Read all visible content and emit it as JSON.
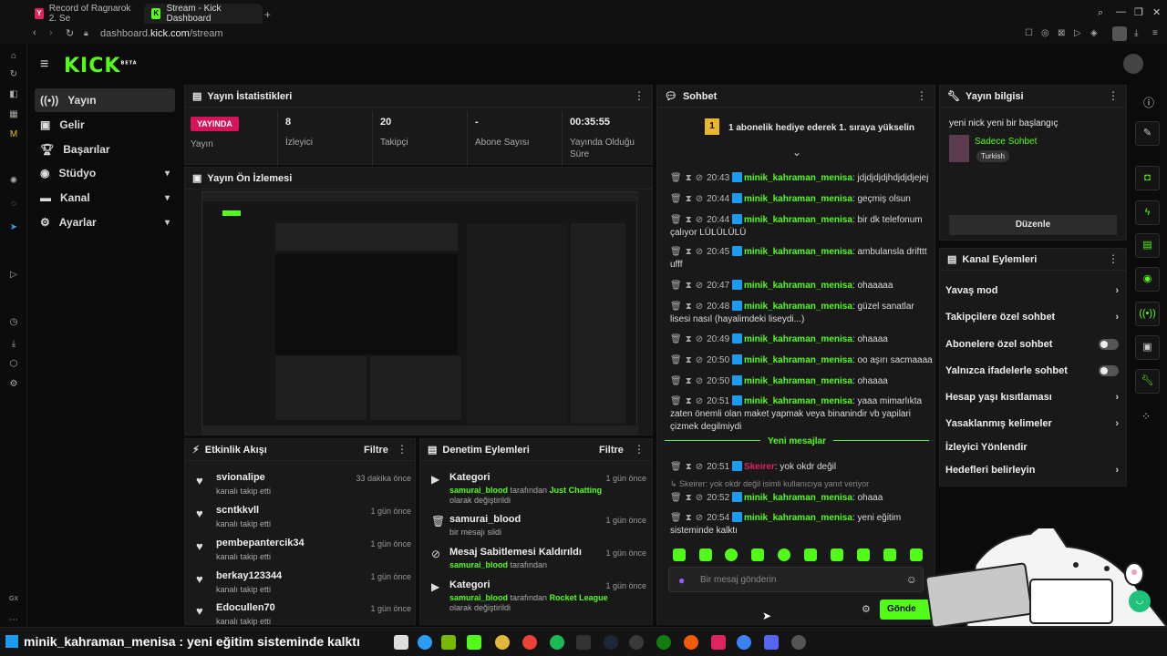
{
  "browser": {
    "tabs": [
      {
        "title": "Record of Ragnarok 2. Se",
        "favicon": "Y"
      },
      {
        "title": "Stream - Kick Dashboard",
        "favicon": "K"
      }
    ],
    "url_prefix": "dashboard.",
    "url_domain": "kick.com",
    "url_path": "/stream"
  },
  "app": {
    "logo": "KICK",
    "logo_tag": "BETA"
  },
  "sidebar": {
    "items": [
      {
        "label": "Yayın",
        "icon": "radio-icon"
      },
      {
        "label": "Gelir",
        "icon": "revenue-icon"
      },
      {
        "label": "Başarılar",
        "icon": "trophy-icon"
      },
      {
        "label": "Stüdyo",
        "icon": "studio-icon"
      },
      {
        "label": "Kanal",
        "icon": "channel-icon"
      },
      {
        "label": "Ayarlar",
        "icon": "gear-icon"
      }
    ]
  },
  "stats": {
    "title": "Yayın İstatistikleri",
    "live_badge": "YAYINDA",
    "live_label": "Yayın",
    "cells": [
      {
        "value": "8",
        "label": "İzleyici"
      },
      {
        "value": "20",
        "label": "Takipçi"
      },
      {
        "value": "-",
        "label": "Abone Sayısı"
      },
      {
        "value": "00:35:55",
        "label": "Yayında Olduğu Süre"
      }
    ]
  },
  "preview": {
    "title": "Yayın Ön İzlemesi"
  },
  "activity": {
    "title": "Etkinlik Akışı",
    "filter": "Filtre",
    "rows": [
      {
        "name": "svionalipe",
        "sub": "kanalı takip etti",
        "time": "33 dakika önce"
      },
      {
        "name": "scntkkvll",
        "sub": "kanalı takip etti",
        "time": "1 gün önce"
      },
      {
        "name": "pembepantercik34",
        "sub": "kanalı takip etti",
        "time": "1 gün önce"
      },
      {
        "name": "berkay123344",
        "sub": "kanalı takip etti",
        "time": "1 gün önce"
      },
      {
        "name": "Edocullen70",
        "sub": "kanalı takip etti",
        "time": "1 gün önce"
      }
    ]
  },
  "moderation": {
    "title": "Denetim Eylemleri",
    "filter": "Filtre",
    "rows": [
      {
        "name": "Kategori",
        "user": "samurai_blood",
        "mid": " tarafından ",
        "hl": "Just Chatting",
        "tail": " olarak değiştirildi",
        "time": "1 gün önce"
      },
      {
        "name": "samurai_blood",
        "user": "",
        "mid": "bir mesajı sildi",
        "hl": "",
        "tail": "",
        "time": "1 gün önce"
      },
      {
        "name": "Mesaj Sabitlemesi Kaldırıldı",
        "user": "samurai_blood",
        "mid": " tarafından",
        "hl": "",
        "tail": "",
        "time": "1 gün önce"
      },
      {
        "name": "Kategori",
        "user": "samurai_blood",
        "mid": " tarafından ",
        "hl": "Rocket League",
        "tail": " olarak değiştirildi",
        "time": "1 gün önce"
      }
    ]
  },
  "chat": {
    "title": "Sohbet",
    "gift_text": "1 abonelik hediye ederek 1. sıraya yükselin",
    "gift_rank": "1",
    "messages": [
      {
        "time": "20:43",
        "user": "minik_kahraman_menisa",
        "text": "jdjdjdjdjhdjdjdjejej"
      },
      {
        "time": "20:44",
        "user": "minik_kahraman_menisa",
        "text": "geçmiş olsun"
      },
      {
        "time": "20:44",
        "user": "minik_kahraman_menisa",
        "text": "bir dk telefonum çalıyor LÜLÜLÜLÜ"
      },
      {
        "time": "20:45",
        "user": "minik_kahraman_menisa",
        "text": "ambulansla drifttt ufff"
      },
      {
        "time": "20:47",
        "user": "minik_kahraman_menisa",
        "text": "ohaaaaa"
      },
      {
        "time": "20:48",
        "user": "minik_kahraman_menisa",
        "text": "güzel sanatlar lisesi nasıl (hayalimdeki liseydi...)"
      },
      {
        "time": "20:49",
        "user": "minik_kahraman_menisa",
        "text": "ohaaaa"
      },
      {
        "time": "20:50",
        "user": "minik_kahraman_menisa",
        "text": "oo aşırı sacmaaaa"
      },
      {
        "time": "20:50",
        "user": "minik_kahraman_menisa",
        "text": "ohaaaa"
      },
      {
        "time": "20:51",
        "user": "minik_kahraman_menisa",
        "text": "yaaa mimarlıkta zaten önemli olan maket yapmak veya binanindir vb yapilari çizmek degilmiydi"
      }
    ],
    "new_divider": "Yeni mesajlar",
    "after": [
      {
        "time": "20:51",
        "user": "Skeirer",
        "text": "yok okdr değil",
        "red": true
      },
      {
        "time": "20:52",
        "user": "minik_kahraman_menisa",
        "text": "ohaaa"
      },
      {
        "time": "20:54",
        "user": "minik_kahraman_menisa",
        "text": "yeni eğitim sisteminde kalktı"
      }
    ],
    "reply_note": "Skeirer: yok okdr değil isimli kullanıcıya yanıt veriyor",
    "input_placeholder": "Bir mesaj gönderin",
    "send_label": "Gönde"
  },
  "info": {
    "title": "Yayın bilgisi",
    "stream_title": "yeni nick yeni bir başlangıç",
    "category": "Sadece Sohbet",
    "tag": "Turkish",
    "edit_label": "Düzenle"
  },
  "channel_actions": {
    "title": "Kanal Eylemleri",
    "items": [
      {
        "label": "Yavaş mod",
        "kind": "chevron"
      },
      {
        "label": "Takipçilere özel sohbet",
        "kind": "chevron"
      },
      {
        "label": "Abonelere özel sohbet",
        "kind": "toggle"
      },
      {
        "label": "Yalnızca ifadelerle sohbet",
        "kind": "toggle"
      },
      {
        "label": "Hesap yaşı kısıtlaması",
        "kind": "chevron"
      },
      {
        "label": "Yasaklanmış kelimeler",
        "kind": "chevron"
      },
      {
        "label": "İzleyici Yönlendir",
        "kind": "none"
      },
      {
        "label": "Hedefleri belirleyin",
        "kind": "chevron"
      }
    ]
  },
  "overlay": {
    "user": "minik_kahraman_menisa",
    "sep": " : ",
    "text": "yeni eğitim sisteminde kalktı"
  },
  "colors": {
    "accent": "#53fc18",
    "live": "#d4145a",
    "panel": "#191919"
  }
}
